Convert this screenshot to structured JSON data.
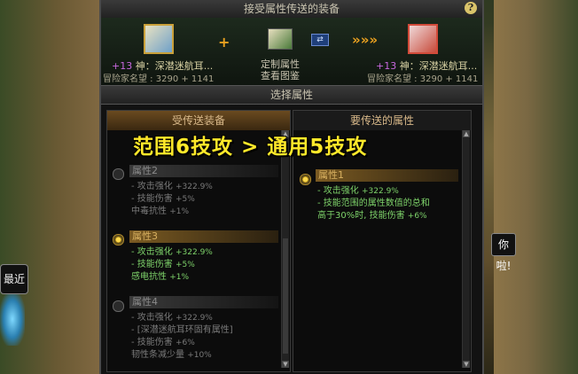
{
  "header": {
    "title": "接受属性传送的装备",
    "help": "?"
  },
  "equip": {
    "source": {
      "plus": "+13",
      "name": "神：深潜迷航耳...",
      "rep": "冒险家名望 : 3290 + 1141"
    },
    "target": {
      "plus": "+13",
      "name": "神：深潜迷航耳...",
      "rep": "冒险家名望 : 3290 + 1141"
    },
    "center_line1": "定制属性",
    "center_line2": "查看图鉴",
    "plus_sign": "+",
    "arrows": "»»»"
  },
  "select_header": "选择属性",
  "left_column": {
    "title": "受传送装备",
    "options": [
      {
        "label": "属性2",
        "lines": [
          {
            "text": "- 攻击强化",
            "val": "+322.9%"
          },
          {
            "text": "- 技能伤害",
            "val": "+5%"
          },
          {
            "text": "  中毒抗性",
            "val": "+1%"
          }
        ]
      },
      {
        "label": "属性3",
        "lines": [
          {
            "text": "- 攻击强化",
            "val": "+322.9%"
          },
          {
            "text": "- 技能伤害",
            "val": "+5%"
          },
          {
            "text": "  感电抗性",
            "val": "+1%"
          }
        ]
      },
      {
        "label": "属性4",
        "lines": [
          {
            "text": "- 攻击强化",
            "val": "+322.9%"
          },
          {
            "text": "- [深潜迷航耳环固有属性]",
            "val": ""
          },
          {
            "text": "- 技能伤害",
            "val": "+6%"
          },
          {
            "text": "  韧性条减少量",
            "val": "+10%"
          }
        ]
      }
    ]
  },
  "right_column": {
    "title": "要传送的属性",
    "option": {
      "label": "属性1",
      "lines": [
        {
          "text": "- 攻击强化",
          "val": "+322.9%"
        },
        {
          "text": "- 技能范围的属性数值的总和",
          "val": ""
        },
        {
          "text": "  高于30%时, 技能伤害",
          "val": "+6%"
        }
      ]
    }
  },
  "banner": "范围6技攻 > 通用5技攻",
  "background": {
    "left_bubble": "最近",
    "right_bubble": "你啦!"
  },
  "colors": {
    "accent": "#ffe92a",
    "active_text": "#7ed36a",
    "inactive_text": "#7a7a7a",
    "plus_purple": "#c968e0"
  }
}
